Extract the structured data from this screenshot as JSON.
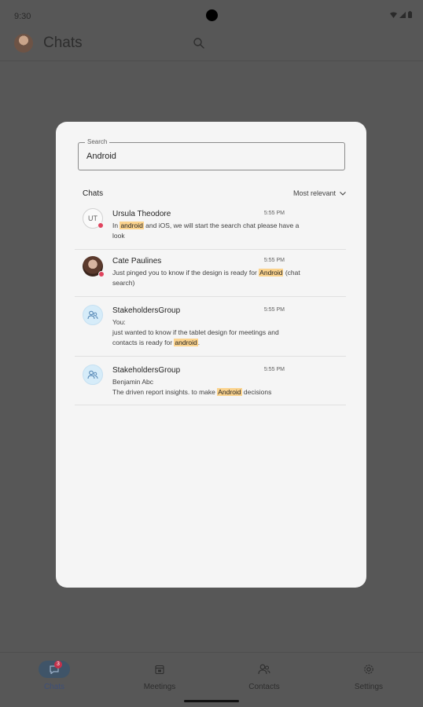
{
  "status_bar": {
    "time": "9:30"
  },
  "header": {
    "title": "Chats"
  },
  "search": {
    "label": "Search",
    "value": "Android"
  },
  "results": {
    "section_title": "Chats",
    "sort_label": "Most relevant",
    "items": [
      {
        "initials": "UT",
        "name": "Ursula Theodore",
        "time": "5:55 PM",
        "l1a": "In ",
        "l1h": "android",
        "l1b": " and iOS, we will start the search chat please have a",
        "l2": "look"
      },
      {
        "name": "Cate Paulines",
        "time": "5:55 PM",
        "l1a": "Just pinged you to know if the design is ready for ",
        "l1h": "Android",
        "l1b": " (chat",
        "l2": "search)"
      },
      {
        "name": "StakeholdersGroup",
        "time": "5:55 PM",
        "l1": "You:",
        "l2": "just wanted to know if the tablet design for meetings and",
        "l3a": "contacts is ready for ",
        "l3h": "android",
        "l3b": "."
      },
      {
        "name": "StakeholdersGroup",
        "time": "5:55 PM",
        "l1": "Benjamin Abc",
        "l2a": "The driven report insights.  to make ",
        "l2h": "Android",
        "l2b": " decisions"
      }
    ]
  },
  "nav": {
    "chats": "Chats",
    "chats_badge": "3",
    "meetings": "Meetings",
    "contacts": "Contacts",
    "settings": "Settings"
  },
  "colors": {
    "highlight": "#fbd38d",
    "presence": "#e0445e",
    "badge": "#c4314b"
  }
}
